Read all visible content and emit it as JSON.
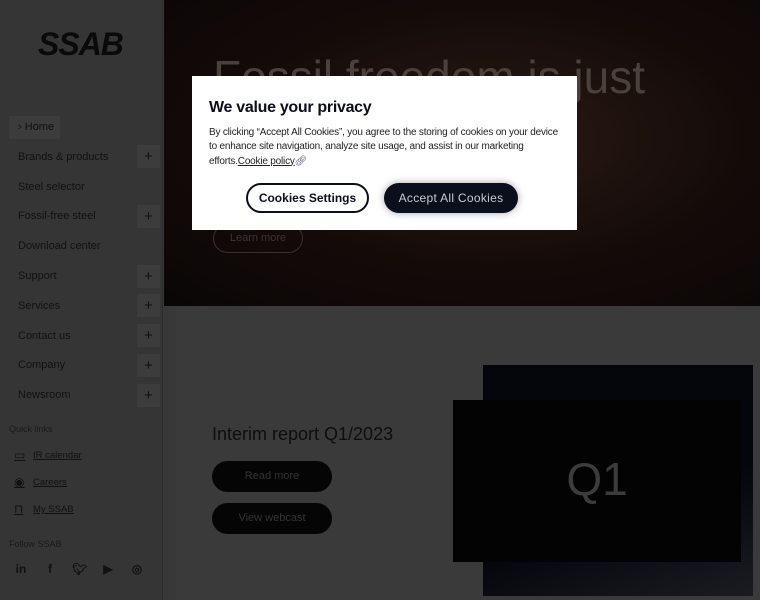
{
  "sidebar": {
    "logo": "SSAB",
    "home": "Home",
    "items": [
      {
        "label": "Brands & products",
        "expandable": true
      },
      {
        "label": "Steel selector",
        "expandable": false
      },
      {
        "label": "Fossil-free steel",
        "expandable": true
      },
      {
        "label": "Download center",
        "expandable": false
      },
      {
        "label": "Support",
        "expandable": true
      },
      {
        "label": "Services",
        "expandable": true
      },
      {
        "label": "Contact us",
        "expandable": true
      },
      {
        "label": "Company",
        "expandable": true
      },
      {
        "label": "Newsroom",
        "expandable": true
      }
    ],
    "quick_links_label": "Quick links",
    "quick_links": [
      {
        "label": "IR calendar",
        "icon": "calendar-icon"
      },
      {
        "label": "Careers",
        "icon": "user-circle-icon"
      },
      {
        "label": "My SSAB",
        "icon": "lock-icon"
      }
    ],
    "follow_label": "Follow SSAB",
    "social": [
      "linkedin-icon",
      "facebook-icon",
      "twitter-icon",
      "youtube-icon",
      "instagram-icon"
    ]
  },
  "hero": {
    "title": "Fossil freedom is just",
    "button": "Learn more"
  },
  "report": {
    "title": "Interim report Q1/2023",
    "read_more": "Read more",
    "webcast": "View webcast",
    "image_text": "Q1"
  },
  "cookie_modal": {
    "title": "We value your privacy",
    "body": "By clicking “Accept All Cookies”, you agree to the storing of cookies on your device to enhance site navigation, analyze site usage, and assist in our marketing efforts.",
    "policy_link": "Cookie policy",
    "settings_button": "Cookies Settings",
    "accept_button": "Accept All Cookies"
  }
}
